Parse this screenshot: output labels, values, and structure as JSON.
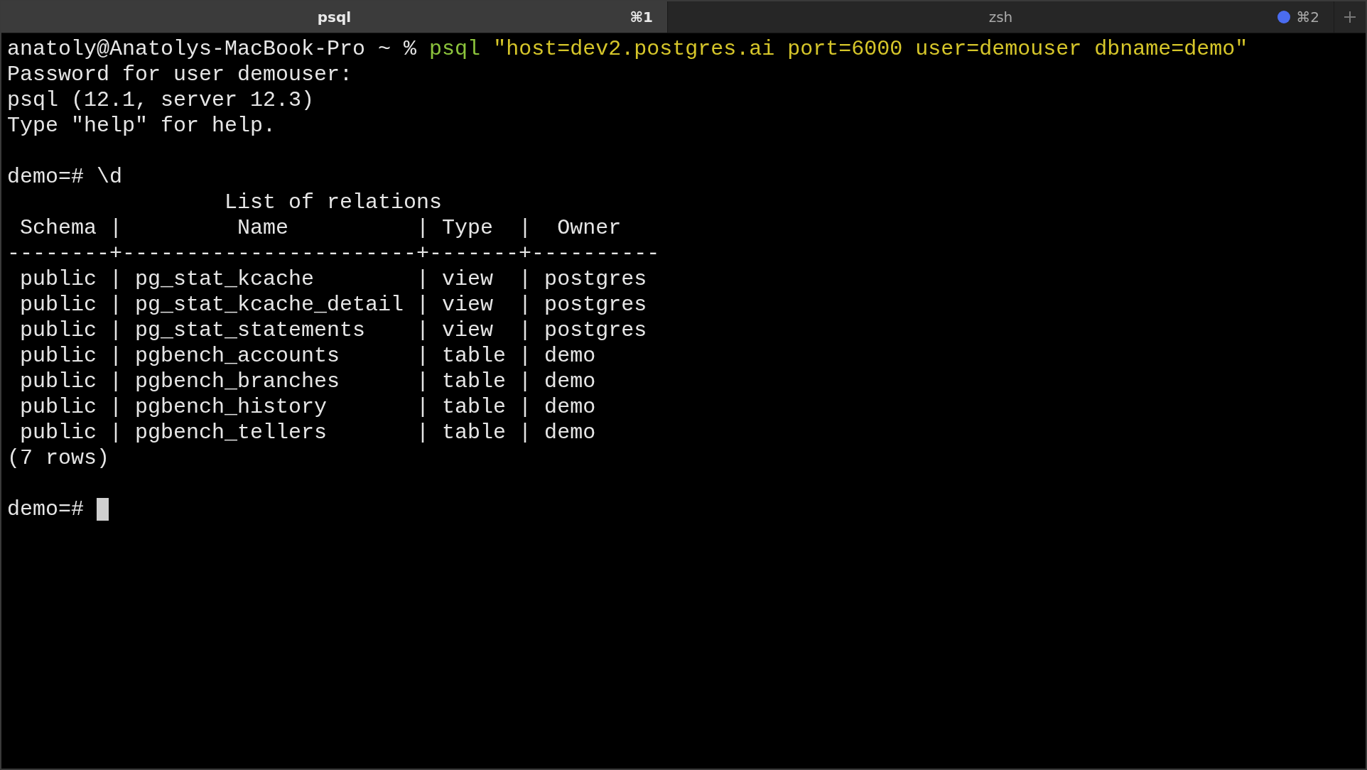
{
  "tabs": [
    {
      "title": "psql",
      "shortcut": "⌘1",
      "selected": true,
      "activity": false
    },
    {
      "title": "zsh",
      "shortcut": "⌘2",
      "selected": false,
      "activity": true
    }
  ],
  "terminal": {
    "lines": [
      {
        "kind": "text",
        "segments": [
          {
            "kind": "plain",
            "text": "anatoly@Anatolys-MacBook-Pro ~ % "
          },
          {
            "kind": "command",
            "text": "psql"
          },
          {
            "kind": "string",
            "text": " \"host=dev2.postgres.ai port=6000 user=demouser dbname=demo\""
          }
        ]
      },
      {
        "kind": "text",
        "segments": [
          {
            "kind": "plain",
            "text": "Password for user demouser:"
          }
        ]
      },
      {
        "kind": "text",
        "segments": [
          {
            "kind": "plain",
            "text": "psql (12.1, server 12.3)"
          }
        ]
      },
      {
        "kind": "text",
        "segments": [
          {
            "kind": "plain",
            "text": "Type \"help\" for help."
          }
        ]
      },
      {
        "kind": "blank"
      },
      {
        "kind": "text",
        "segments": [
          {
            "kind": "plain",
            "text": "demo=# \\d"
          }
        ]
      },
      {
        "kind": "text",
        "segments": [
          {
            "kind": "plain",
            "text": "                 List of relations"
          }
        ]
      },
      {
        "kind": "text",
        "segments": [
          {
            "kind": "plain",
            "text": " Schema |         Name          | Type  |  Owner"
          }
        ]
      },
      {
        "kind": "text",
        "segments": [
          {
            "kind": "plain",
            "text": "--------+-----------------------+-------+----------"
          }
        ]
      },
      {
        "kind": "text",
        "segments": [
          {
            "kind": "plain",
            "text": " public | pg_stat_kcache        | view  | postgres"
          }
        ]
      },
      {
        "kind": "text",
        "segments": [
          {
            "kind": "plain",
            "text": " public | pg_stat_kcache_detail | view  | postgres"
          }
        ]
      },
      {
        "kind": "text",
        "segments": [
          {
            "kind": "plain",
            "text": " public | pg_stat_statements    | view  | postgres"
          }
        ]
      },
      {
        "kind": "text",
        "segments": [
          {
            "kind": "plain",
            "text": " public | pgbench_accounts      | table | demo"
          }
        ]
      },
      {
        "kind": "text",
        "segments": [
          {
            "kind": "plain",
            "text": " public | pgbench_branches      | table | demo"
          }
        ]
      },
      {
        "kind": "text",
        "segments": [
          {
            "kind": "plain",
            "text": " public | pgbench_history       | table | demo"
          }
        ]
      },
      {
        "kind": "text",
        "segments": [
          {
            "kind": "plain",
            "text": " public | pgbench_tellers       | table | demo"
          }
        ]
      },
      {
        "kind": "text",
        "segments": [
          {
            "kind": "plain",
            "text": "(7 rows)"
          }
        ]
      },
      {
        "kind": "blank"
      },
      {
        "kind": "prompt",
        "segments": [
          {
            "kind": "plain",
            "text": "demo=# "
          }
        ],
        "cursor": true
      }
    ]
  }
}
